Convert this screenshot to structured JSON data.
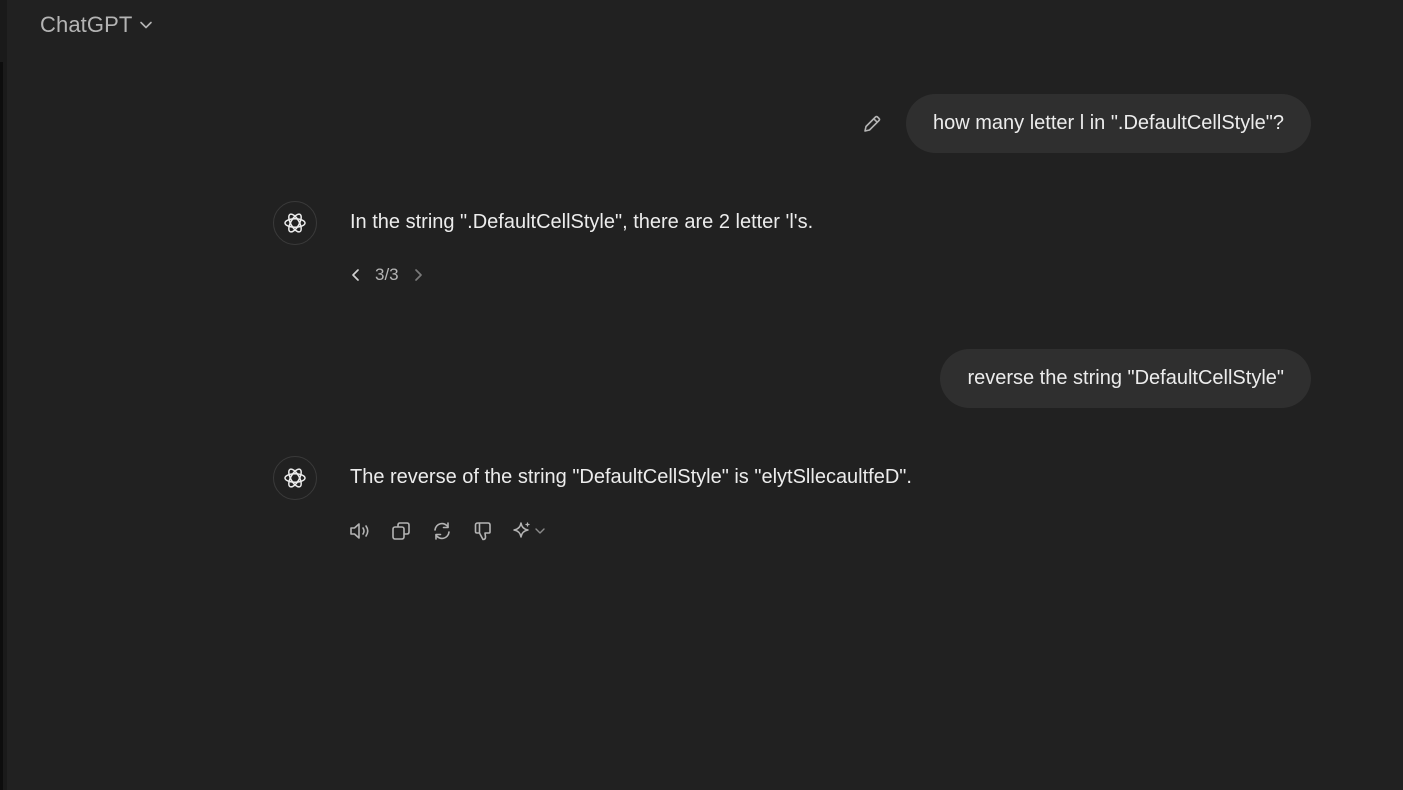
{
  "header": {
    "title": "ChatGPT",
    "dropdown_icon": "chevron-down-icon"
  },
  "conversation": [
    {
      "role": "user",
      "text": "how many letter l in \".DefaultCellStyle\"?",
      "edit_icon": "pencil-icon"
    },
    {
      "role": "assistant",
      "text": "In the string \".DefaultCellStyle\", there are 2 letter 'l's.",
      "pagination": {
        "label": "3/3",
        "prev_icon": "chevron-left-icon",
        "next_icon": "chevron-right-icon"
      }
    },
    {
      "role": "user",
      "text": "reverse the string \"DefaultCellStyle\""
    },
    {
      "role": "assistant",
      "text": "The reverse of the string \"DefaultCellStyle\" is \"elytSllecaultfeD\".",
      "actions": [
        "speaker-icon",
        "copy-icon",
        "regenerate-icon",
        "thumbs-down-icon",
        "sparkle-model-switch-icon"
      ]
    }
  ],
  "colors": {
    "background": "#212121",
    "bubble": "#2f2f2f",
    "text": "#ececec",
    "muted": "#b4b4b4"
  }
}
